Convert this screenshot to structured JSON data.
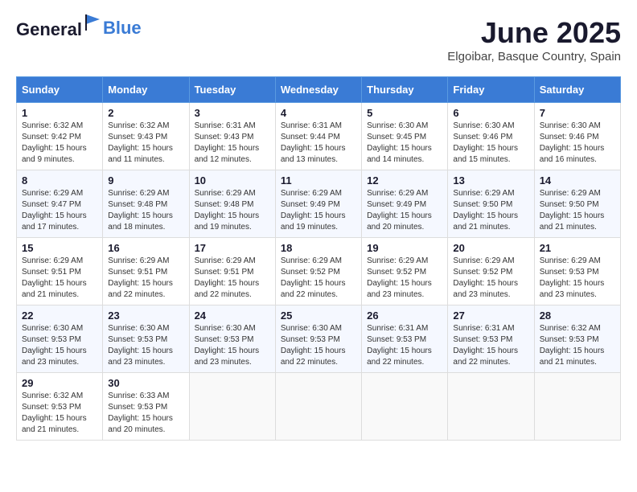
{
  "logo": {
    "text_general": "General",
    "text_blue": "Blue"
  },
  "title": "June 2025",
  "location": "Elgoibar, Basque Country, Spain",
  "headers": [
    "Sunday",
    "Monday",
    "Tuesday",
    "Wednesday",
    "Thursday",
    "Friday",
    "Saturday"
  ],
  "weeks": [
    [
      {
        "day": "1",
        "sunrise": "Sunrise: 6:32 AM",
        "sunset": "Sunset: 9:42 PM",
        "daylight": "Daylight: 15 hours and 9 minutes."
      },
      {
        "day": "2",
        "sunrise": "Sunrise: 6:32 AM",
        "sunset": "Sunset: 9:43 PM",
        "daylight": "Daylight: 15 hours and 11 minutes."
      },
      {
        "day": "3",
        "sunrise": "Sunrise: 6:31 AM",
        "sunset": "Sunset: 9:43 PM",
        "daylight": "Daylight: 15 hours and 12 minutes."
      },
      {
        "day": "4",
        "sunrise": "Sunrise: 6:31 AM",
        "sunset": "Sunset: 9:44 PM",
        "daylight": "Daylight: 15 hours and 13 minutes."
      },
      {
        "day": "5",
        "sunrise": "Sunrise: 6:30 AM",
        "sunset": "Sunset: 9:45 PM",
        "daylight": "Daylight: 15 hours and 14 minutes."
      },
      {
        "day": "6",
        "sunrise": "Sunrise: 6:30 AM",
        "sunset": "Sunset: 9:46 PM",
        "daylight": "Daylight: 15 hours and 15 minutes."
      },
      {
        "day": "7",
        "sunrise": "Sunrise: 6:30 AM",
        "sunset": "Sunset: 9:46 PM",
        "daylight": "Daylight: 15 hours and 16 minutes."
      }
    ],
    [
      {
        "day": "8",
        "sunrise": "Sunrise: 6:29 AM",
        "sunset": "Sunset: 9:47 PM",
        "daylight": "Daylight: 15 hours and 17 minutes."
      },
      {
        "day": "9",
        "sunrise": "Sunrise: 6:29 AM",
        "sunset": "Sunset: 9:48 PM",
        "daylight": "Daylight: 15 hours and 18 minutes."
      },
      {
        "day": "10",
        "sunrise": "Sunrise: 6:29 AM",
        "sunset": "Sunset: 9:48 PM",
        "daylight": "Daylight: 15 hours and 19 minutes."
      },
      {
        "day": "11",
        "sunrise": "Sunrise: 6:29 AM",
        "sunset": "Sunset: 9:49 PM",
        "daylight": "Daylight: 15 hours and 19 minutes."
      },
      {
        "day": "12",
        "sunrise": "Sunrise: 6:29 AM",
        "sunset": "Sunset: 9:49 PM",
        "daylight": "Daylight: 15 hours and 20 minutes."
      },
      {
        "day": "13",
        "sunrise": "Sunrise: 6:29 AM",
        "sunset": "Sunset: 9:50 PM",
        "daylight": "Daylight: 15 hours and 21 minutes."
      },
      {
        "day": "14",
        "sunrise": "Sunrise: 6:29 AM",
        "sunset": "Sunset: 9:50 PM",
        "daylight": "Daylight: 15 hours and 21 minutes."
      }
    ],
    [
      {
        "day": "15",
        "sunrise": "Sunrise: 6:29 AM",
        "sunset": "Sunset: 9:51 PM",
        "daylight": "Daylight: 15 hours and 21 minutes."
      },
      {
        "day": "16",
        "sunrise": "Sunrise: 6:29 AM",
        "sunset": "Sunset: 9:51 PM",
        "daylight": "Daylight: 15 hours and 22 minutes."
      },
      {
        "day": "17",
        "sunrise": "Sunrise: 6:29 AM",
        "sunset": "Sunset: 9:51 PM",
        "daylight": "Daylight: 15 hours and 22 minutes."
      },
      {
        "day": "18",
        "sunrise": "Sunrise: 6:29 AM",
        "sunset": "Sunset: 9:52 PM",
        "daylight": "Daylight: 15 hours and 22 minutes."
      },
      {
        "day": "19",
        "sunrise": "Sunrise: 6:29 AM",
        "sunset": "Sunset: 9:52 PM",
        "daylight": "Daylight: 15 hours and 23 minutes."
      },
      {
        "day": "20",
        "sunrise": "Sunrise: 6:29 AM",
        "sunset": "Sunset: 9:52 PM",
        "daylight": "Daylight: 15 hours and 23 minutes."
      },
      {
        "day": "21",
        "sunrise": "Sunrise: 6:29 AM",
        "sunset": "Sunset: 9:53 PM",
        "daylight": "Daylight: 15 hours and 23 minutes."
      }
    ],
    [
      {
        "day": "22",
        "sunrise": "Sunrise: 6:30 AM",
        "sunset": "Sunset: 9:53 PM",
        "daylight": "Daylight: 15 hours and 23 minutes."
      },
      {
        "day": "23",
        "sunrise": "Sunrise: 6:30 AM",
        "sunset": "Sunset: 9:53 PM",
        "daylight": "Daylight: 15 hours and 23 minutes."
      },
      {
        "day": "24",
        "sunrise": "Sunrise: 6:30 AM",
        "sunset": "Sunset: 9:53 PM",
        "daylight": "Daylight: 15 hours and 23 minutes."
      },
      {
        "day": "25",
        "sunrise": "Sunrise: 6:30 AM",
        "sunset": "Sunset: 9:53 PM",
        "daylight": "Daylight: 15 hours and 22 minutes."
      },
      {
        "day": "26",
        "sunrise": "Sunrise: 6:31 AM",
        "sunset": "Sunset: 9:53 PM",
        "daylight": "Daylight: 15 hours and 22 minutes."
      },
      {
        "day": "27",
        "sunrise": "Sunrise: 6:31 AM",
        "sunset": "Sunset: 9:53 PM",
        "daylight": "Daylight: 15 hours and 22 minutes."
      },
      {
        "day": "28",
        "sunrise": "Sunrise: 6:32 AM",
        "sunset": "Sunset: 9:53 PM",
        "daylight": "Daylight: 15 hours and 21 minutes."
      }
    ],
    [
      {
        "day": "29",
        "sunrise": "Sunrise: 6:32 AM",
        "sunset": "Sunset: 9:53 PM",
        "daylight": "Daylight: 15 hours and 21 minutes."
      },
      {
        "day": "30",
        "sunrise": "Sunrise: 6:33 AM",
        "sunset": "Sunset: 9:53 PM",
        "daylight": "Daylight: 15 hours and 20 minutes."
      },
      null,
      null,
      null,
      null,
      null
    ]
  ]
}
